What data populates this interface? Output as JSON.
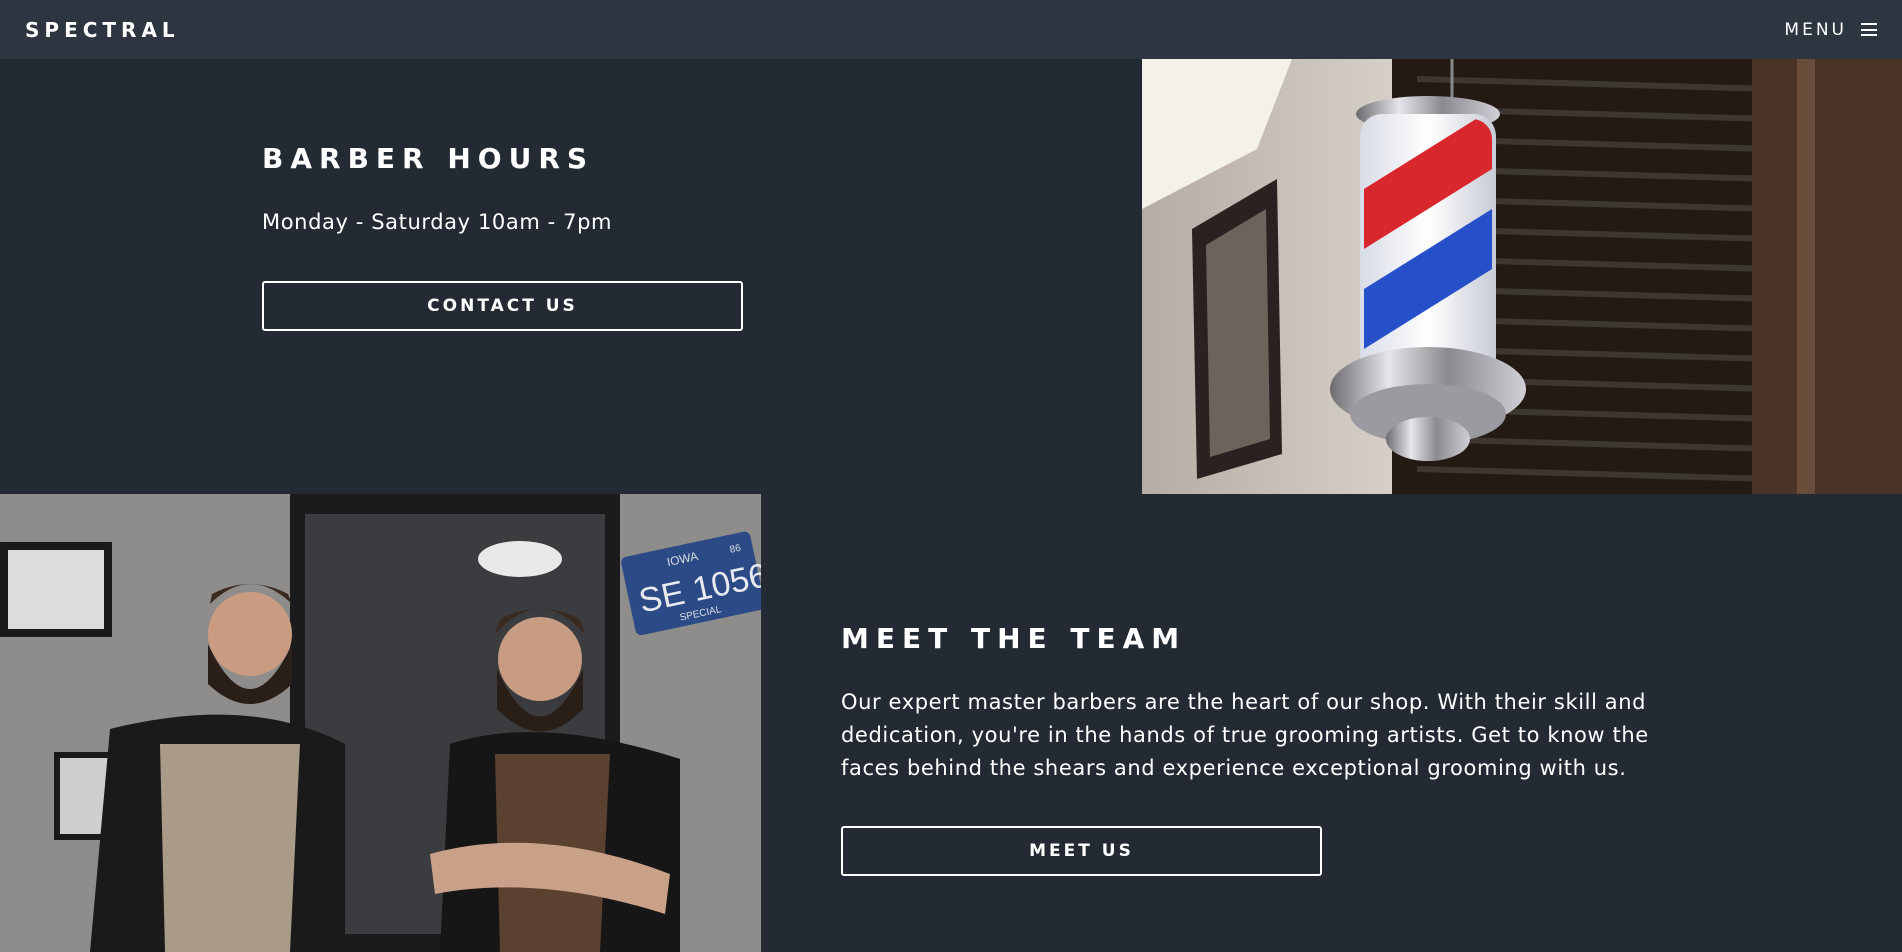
{
  "header": {
    "brand": "SPECTRAL",
    "menu_label": "MENU",
    "menu_icon": "hamburger-icon"
  },
  "hours": {
    "title": "BARBER HOURS",
    "text": "Monday - Saturday 10am - 7pm",
    "button": "CONTACT US",
    "image_icon": "barber-pole-photo"
  },
  "team": {
    "title": "MEET THE TEAM",
    "text": "Our expert master barbers are the heart of our shop. With their skill and dedication, you're in the hands of true grooming artists. Get to know the faces behind the shears and experience exceptional grooming with us.",
    "button": "MEET US",
    "image_icon": "barbers-photo",
    "plate": {
      "state": "IOWA",
      "year": "86",
      "number": "SE 1056",
      "footer": "SPECIAL"
    }
  },
  "colors": {
    "bg": "#242a33",
    "nav": "#2d3540",
    "text": "#ffffff"
  }
}
